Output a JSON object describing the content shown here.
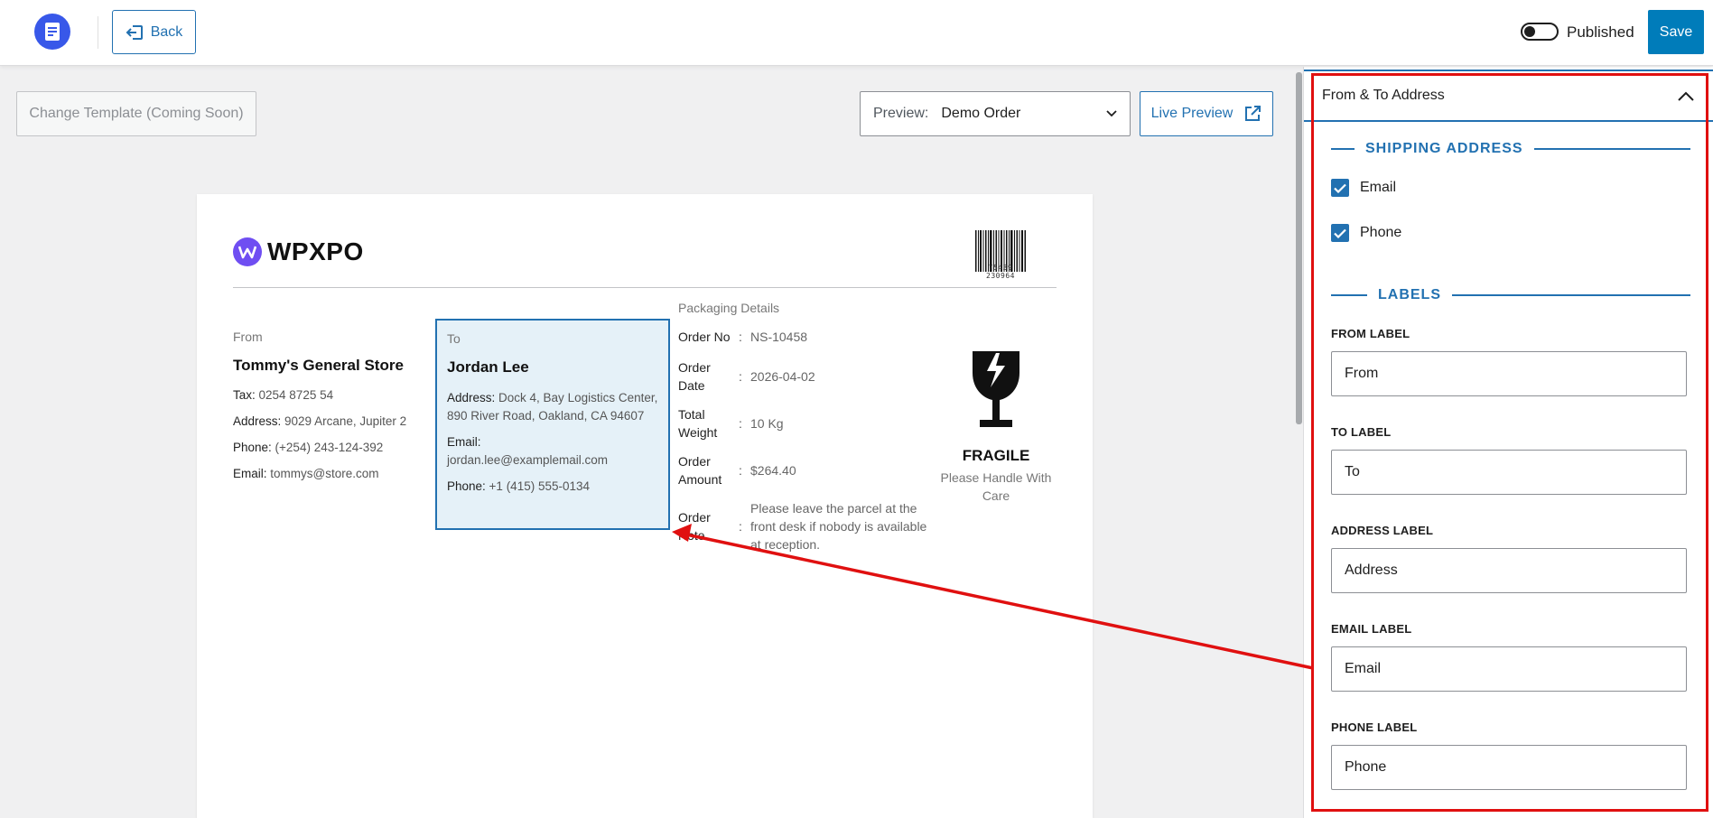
{
  "topbar": {
    "back_label": "Back",
    "published_label": "Published",
    "published_on": false,
    "save_label": "Save"
  },
  "toolbar": {
    "change_template_label": "Change Template (Coming Soon)",
    "preview_label": "Preview:",
    "preview_value": "Demo Order",
    "live_preview_label": "Live Preview"
  },
  "document": {
    "brand_name": "WPXPO",
    "barcode_number": "75439  230964",
    "from": {
      "title": "From",
      "name": "Tommy's General Store",
      "tax_key": "Tax:",
      "tax_val": " 0254 8725 54",
      "address_key": "Address:",
      "address_val": " 9029 Arcane, Jupiter 2",
      "phone_key": "Phone:",
      "phone_val": " (+254) 243-124-392",
      "email_key": "Email:",
      "email_val": " tommys@store.com"
    },
    "to": {
      "title": "To",
      "name": "Jordan Lee",
      "address_key": "Address:",
      "address_val": " Dock 4, Bay Logistics Center, 890 River Road, Oakland, CA 94607",
      "email_key": "Email:",
      "email_val": "jordan.lee@examplemail.com",
      "phone_key": "Phone:",
      "phone_val": " +1 (415) 555-0134"
    },
    "packaging": {
      "title": "Packaging Details",
      "rows": [
        {
          "key": "Order No",
          "sep": ":",
          "val": "NS-10458"
        },
        {
          "key": "Order Date",
          "sep": ":",
          "val": "2026-04-02"
        },
        {
          "key": "Total Weight",
          "sep": ":",
          "val": "10 Kg"
        },
        {
          "key": "Order Amount",
          "sep": ":",
          "val": "$264.40"
        },
        {
          "key": "Order Note",
          "sep": ":",
          "val": "Please leave the parcel at the front desk if nobody is available at reception."
        }
      ]
    },
    "fragile": {
      "icon": "fragile-glass-icon",
      "title": "FRAGILE",
      "subtitle": "Please Handle With Care"
    }
  },
  "panel": {
    "title": "From & To Address",
    "shipping_section": "SHIPPING ADDRESS",
    "checks": [
      {
        "label": "Email",
        "checked": true
      },
      {
        "label": "Phone",
        "checked": true
      }
    ],
    "labels_section": "LABELS",
    "fields": [
      {
        "label": "FROM LABEL",
        "value": "From"
      },
      {
        "label": "TO LABEL",
        "value": "To"
      },
      {
        "label": "ADDRESS LABEL",
        "value": "Address"
      },
      {
        "label": "EMAIL LABEL",
        "value": "Email"
      },
      {
        "label": "PHONE LABEL",
        "value": "Phone"
      }
    ]
  },
  "colors": {
    "accent": "#2271b1",
    "save": "#007cba",
    "annotation_red": "#e01010",
    "highlight_bg": "#e5f1f8"
  }
}
